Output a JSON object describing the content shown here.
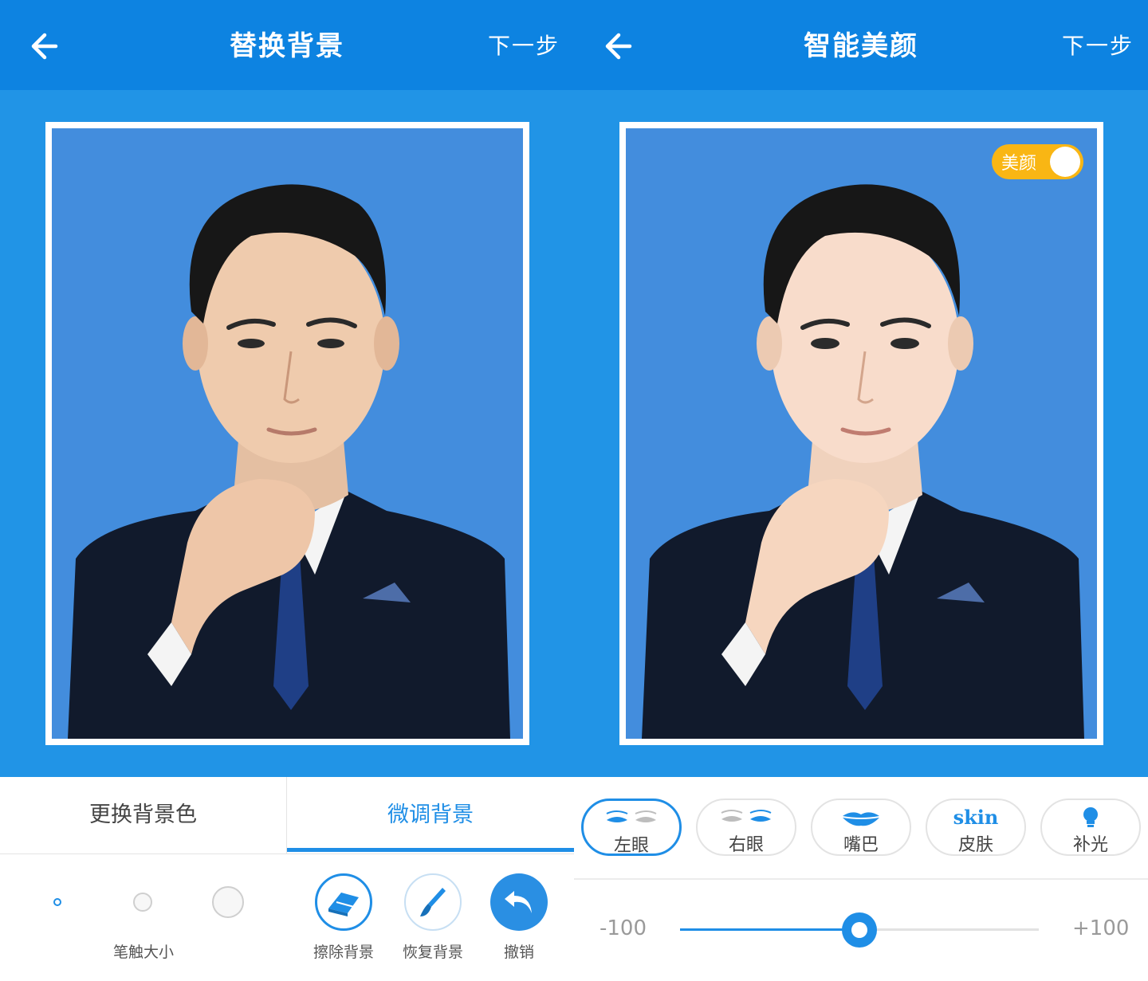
{
  "left": {
    "title": "替换背景",
    "next_label": "下一步",
    "tabs": [
      {
        "label": "更换背景色"
      },
      {
        "label": "微调背景"
      }
    ],
    "brush_size_label": "笔触大小",
    "tools": [
      {
        "label": "擦除背景",
        "icon": "eraser-icon"
      },
      {
        "label": "恢复背景",
        "icon": "paintbrush-icon"
      },
      {
        "label": "撤销",
        "icon": "undo-icon"
      }
    ]
  },
  "right": {
    "title": "智能美颜",
    "next_label": "下一步",
    "beauty_toggle": {
      "label": "美颜",
      "on": true
    },
    "features": [
      {
        "label": "左眼",
        "icon": "left-eye-icon"
      },
      {
        "label": "右眼",
        "icon": "right-eye-icon"
      },
      {
        "label": "嘴巴",
        "icon": "lips-icon"
      },
      {
        "label": "皮肤",
        "icon": "skin-icon"
      },
      {
        "label": "补光",
        "icon": "light-bulb-icon"
      }
    ],
    "skin_icon_text": "skin",
    "slider": {
      "min_label": "-100",
      "max_label": "+100",
      "value": 0
    }
  },
  "colors": {
    "topbar": "#0d83e1",
    "stage": "#2194e6",
    "photo_bg": "#438ddd",
    "accent": "#1f8ee6",
    "toggle": "#f9b614"
  }
}
